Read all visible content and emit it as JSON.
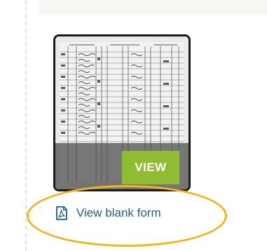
{
  "record": {
    "view_label": "VIEW",
    "blank_form_label": "View blank form"
  },
  "colors": {
    "view_button": "#8fbc30",
    "link": "#1f5f8b",
    "highlight": "#f3b616",
    "thumb_border": "#1a1a1a"
  },
  "icons": {
    "blank_form": "pdf-icon"
  }
}
